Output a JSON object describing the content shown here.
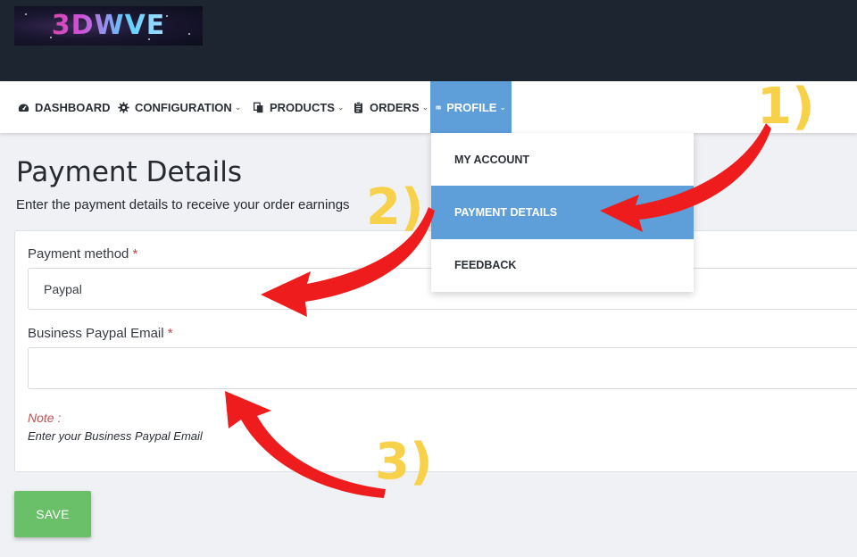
{
  "logo": {
    "text": "3DWVE"
  },
  "nav": {
    "items": [
      {
        "label": "DASHBOARD",
        "icon": "speedometer-icon",
        "dropdown": false
      },
      {
        "label": "CONFIGURATION",
        "icon": "gear-icon",
        "dropdown": true
      },
      {
        "label": "PRODUCTS",
        "icon": "copy-icon",
        "dropdown": true
      },
      {
        "label": "ORDERS",
        "icon": "clipboard-icon",
        "dropdown": true
      },
      {
        "label": "PROFILE",
        "icon": "id-card-icon",
        "dropdown": true,
        "active": true
      }
    ],
    "chevron": "⌄"
  },
  "profile_menu": {
    "items": [
      "MY ACCOUNT",
      "PAYMENT DETAILS",
      "FEEDBACK"
    ],
    "active_item": "PAYMENT DETAILS"
  },
  "page": {
    "title": "Payment Details",
    "subtitle": "Enter the payment details to receive your order earnings"
  },
  "form": {
    "payment_method_label": "Payment method",
    "payment_method_value": "Paypal",
    "email_label": "Business Paypal Email",
    "email_value": "",
    "required_mark": "*",
    "note_title": "Note :",
    "note_text": "Enter your Business Paypal Email"
  },
  "save_label": "SAVE",
  "annotations": {
    "step1": "1)",
    "step2": "2)",
    "step3": "3)",
    "arrow_color": "#ee1c1c",
    "number_color": "#f8d14a"
  },
  "colors": {
    "accent": "#5e9fda",
    "save": "#6abf69",
    "topbar": "#1d2630"
  }
}
